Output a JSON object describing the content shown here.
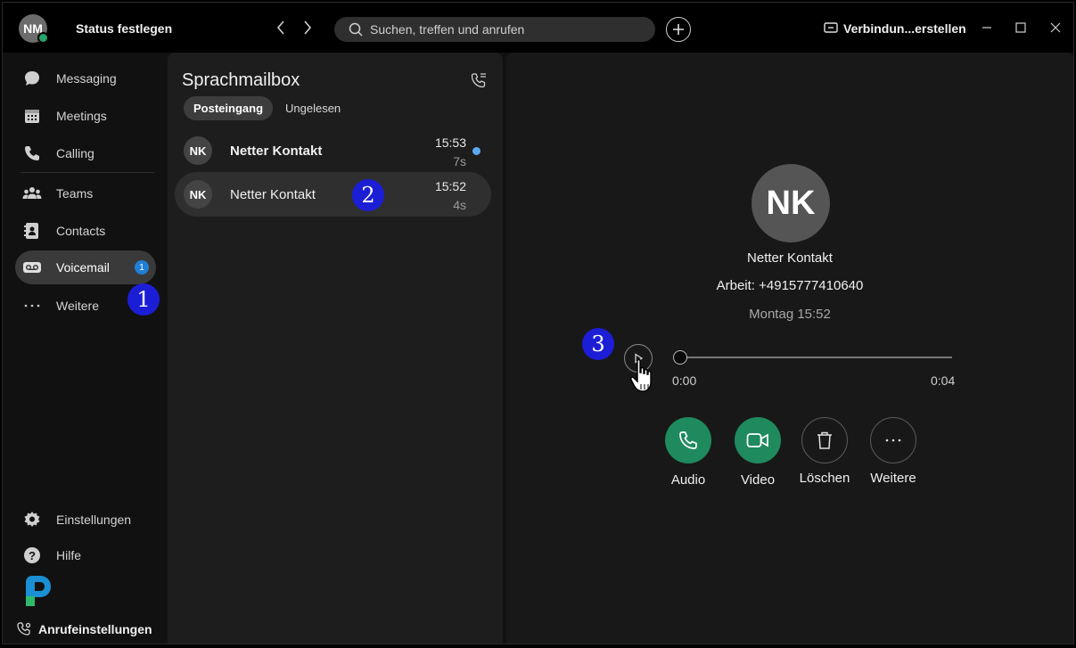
{
  "titlebar": {
    "avatar_initials": "NM",
    "status_label": "Status festlegen",
    "search_placeholder": "Suchen, treffen und anrufen",
    "connect_label": "Verbindun...erstellen"
  },
  "sidebar": {
    "items": [
      {
        "label": "Messaging",
        "icon": "chat-icon"
      },
      {
        "label": "Meetings",
        "icon": "calendar-icon"
      },
      {
        "label": "Calling",
        "icon": "phone-icon"
      },
      {
        "label": "Teams",
        "icon": "teams-icon"
      },
      {
        "label": "Contacts",
        "icon": "contacts-icon"
      },
      {
        "label": "Voicemail",
        "icon": "voicemail-icon",
        "badge": "1",
        "active": true
      },
      {
        "label": "Weitere",
        "icon": "more-icon"
      }
    ],
    "settings_label": "Einstellungen",
    "help_label": "Hilfe",
    "call_settings_label": "Anrufeinstellungen"
  },
  "markers": [
    "1",
    "2",
    "3"
  ],
  "voicemail_panel": {
    "title": "Sprachmailbox",
    "tabs": [
      "Posteingang",
      "Ungelesen"
    ],
    "items": [
      {
        "initials": "NK",
        "name": "Netter Kontakt",
        "time": "15:53",
        "duration": "7s",
        "unread": true
      },
      {
        "initials": "NK",
        "name": "Netter Kontakt",
        "time": "15:52",
        "duration": "4s",
        "unread": false
      }
    ]
  },
  "detail": {
    "initials": "NK",
    "name": "Netter Kontakt",
    "work_number": "Arbeit: +4915777410640",
    "date": "Montag 15:52",
    "player": {
      "current": "0:00",
      "total": "0:04",
      "progress": 0
    },
    "actions": [
      {
        "label": "Audio",
        "icon": "phone-icon"
      },
      {
        "label": "Video",
        "icon": "video-icon"
      },
      {
        "label": "Löschen",
        "icon": "trash-icon"
      },
      {
        "label": "Weitere",
        "icon": "more-icon"
      }
    ]
  },
  "colors": {
    "accent_green": "#1f8a5e",
    "badge_blue": "#1f7fd6",
    "marker_blue": "#1c1ed6",
    "presence_green": "#27a36b"
  }
}
